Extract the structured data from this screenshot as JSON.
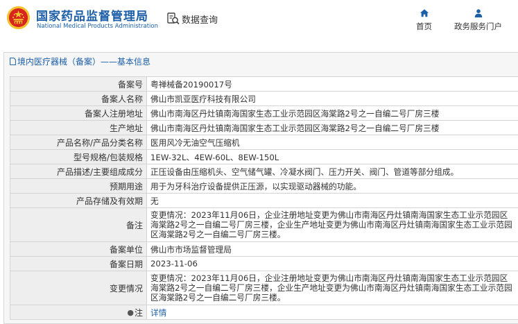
{
  "header": {
    "logo_cn": "国家药品监督管理局",
    "logo_en": "National Medical Products Administration",
    "search_label": "数据查询",
    "nav": [
      {
        "label": "首页",
        "icon": "home-icon"
      },
      {
        "label": "政务服务门户",
        "icon": "user-icon"
      }
    ]
  },
  "breadcrumb": {
    "text": "境内医疗器械（备案）——基本信息",
    "icon": "document-icon"
  },
  "record": {
    "rows": [
      {
        "label": "备案号",
        "value": "粤禅械备20190017号"
      },
      {
        "label": "备案人名称",
        "value": "佛山市凯亚医疗科技有限公司"
      },
      {
        "label": "备案人注册地址",
        "value": "佛山市南海区丹灶镇南海国家生态工业示范园区海棠路2号之一自编二号厂房三楼"
      },
      {
        "label": "生产地址",
        "value": "佛山市南海区丹灶镇南海国家生态工业示范园区海棠路2号之一自编二号厂房三楼"
      },
      {
        "label": "产品名称/产品分类名称",
        "value": "医用风冷无油空气压缩机"
      },
      {
        "label": "型号规格/包装规格",
        "value": "1EW-32L、4EW-60L、8EW-150L"
      },
      {
        "label": "产品描述/主要组成成分",
        "value": "正压设备由压缩机头、空气储气罐、冷凝水阀门、压力开关、阀门、管道等部分组成。"
      },
      {
        "label": "预期用途",
        "value": "用于为牙科治疗设备提供正压源，以实现驱动器械的功能。"
      },
      {
        "label": "产品存储及有效期",
        "value": "无"
      },
      {
        "label": "备注",
        "value": "变更情况：2023年11月06日，企业注册地址变更为佛山市南海区丹灶镇南海国家生态工业示范园区海棠路2号之一自编二号厂房三楼，企业生产地址变更为佛山市南海区丹灶镇南海国家生态工业示范园区海棠路2号之一自编二号厂房三楼。"
      },
      {
        "label": "备案单位",
        "value": "佛山市市场监督管理局"
      },
      {
        "label": "备案日期",
        "value": "2023-11-06"
      },
      {
        "label": "变更情况",
        "value": "变更情况：2023年11月06日，企业注册地址变更为佛山市南海区丹灶镇南海国家生态工业示范园区海棠路2号之一自编二号厂房三楼，企业生产地址变更为佛山市南海区丹灶镇南海国家生态工业示范园区海棠路2号之一自编二号厂房三楼。"
      }
    ],
    "note": {
      "icon_glyph": "●",
      "label": "注",
      "value": "详情"
    }
  },
  "colors": {
    "brand_blue": "#1c5fa8",
    "emblem_red": "#d7261e",
    "emblem_gold": "#f4c430",
    "label_bg": "#eeeeee",
    "border": "#d4d4d4"
  }
}
